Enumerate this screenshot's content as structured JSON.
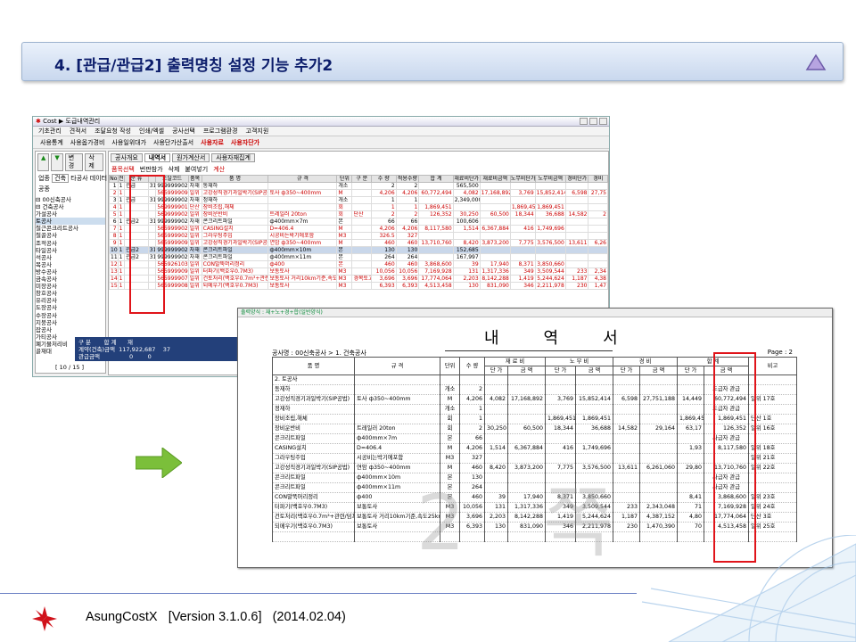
{
  "title": "4. [관급/관급2] 출력명칭 설정 기능 추가2",
  "app": {
    "window_title": "Cost  ▶ 도급내역관리",
    "menu": [
      "기초관리",
      "견적서",
      "조달요청 작성",
      "인쇄/엑셀",
      "공사선택",
      "프로그램환경",
      "고객지원"
    ],
    "toolbar": [
      "사용통계",
      "사용옵가경비",
      "사용일위대가",
      "사용단가산출서",
      "사용자료",
      "사용자단가"
    ],
    "left_buttons": [
      "변경",
      "삭제"
    ],
    "left_labels": [
      "업종",
      "공종"
    ],
    "left_select": "건축",
    "left_select2": "타공사 데이터",
    "tree": [
      "00신축공사",
      "건축공사",
      "가설공사",
      "토공사",
      "철근콘크리트공사",
      "철골공사",
      "조적공사",
      "타일공사",
      "석공사",
      "목공사",
      "방수공사",
      "금속공사",
      "미장공사",
      "창호공사",
      "유리공사",
      "도장공사",
      "수장공사",
      "지붕공사",
      "잡공사",
      "가티공사",
      "폐기물처리비",
      "골재대"
    ],
    "status": "[ 10 / 15 ]",
    "tabs": [
      "공사개요",
      "내역서",
      "원가계산서",
      "사용자재집계"
    ],
    "subbar": [
      "품목선택",
      "번판참가",
      "삭제",
      "붙여넣기",
      "계산"
    ],
    "grid_headers": [
      "No",
      "전",
      "분 류",
      "",
      "조달코드",
      "품목",
      "품 명",
      "규 격",
      "단위",
      "구 분",
      "수 량",
      "적용수량",
      "합 계",
      "재료비단가",
      "재료비금액",
      "노무비단가",
      "노무비금액",
      "경비단가",
      "경비"
    ],
    "grid_rows": [
      [
        "1",
        "1",
        "관급",
        "31",
        "9999999028",
        "자재",
        "동재하",
        "",
        "개소",
        "",
        "2",
        "2",
        "",
        "565,500",
        "",
        "",
        "",
        "",
        ""
      ],
      [
        "2",
        "1",
        "",
        "",
        "5659999092",
        "일위",
        "고강성직경기과일박기(SIP공법)",
        "토사 ф350~400mm",
        "M",
        "",
        "4,206",
        "4,206",
        "60,772,494",
        "4,082",
        "17,168,892",
        "3,769",
        "15,852,414",
        "6,598",
        "27,75"
      ],
      [
        "3",
        "1",
        "관급",
        "31",
        "9999999028",
        "자재",
        "정재하",
        "",
        "개소",
        "",
        "1",
        "1",
        "",
        "2,349,000",
        "",
        "",
        "",
        "",
        ""
      ],
      [
        "4",
        "1",
        "",
        "",
        "5699999019",
        "단산",
        "장비조립,해체",
        "",
        "회",
        "",
        "1",
        "1",
        "1,869,451",
        "",
        "",
        "1,869,451",
        "1,869,451",
        "",
        ""
      ],
      [
        "5",
        "1",
        "",
        "",
        "5699999020",
        "일위",
        "장비운반비",
        "트레일러 20ton",
        "회",
        "단산",
        "2",
        "2",
        "126,352",
        "30,250",
        "60,500",
        "18,344",
        "36,688",
        "14,582",
        "2"
      ],
      [
        "6",
        "1",
        "관급2",
        "31",
        "9999999024",
        "자재",
        "콘크리트파일",
        "ф400mm×7m",
        "본",
        "",
        "66",
        "66",
        "",
        "100,606",
        "",
        "",
        "",
        "",
        ""
      ],
      [
        "7",
        "1",
        "",
        "",
        "5659999023",
        "일위",
        "CASING설치",
        "D=406.4",
        "M",
        "",
        "4,206",
        "4,206",
        "8,117,580",
        "1,514",
        "6,367,884",
        "416",
        "1,749,696",
        "",
        ""
      ],
      [
        "8",
        "1",
        "",
        "",
        "5659999027",
        "일위",
        "그라우팅주입",
        "시공비는박기에포함",
        "M3",
        "",
        "326.5",
        "327",
        "",
        "",
        "",
        "",
        "",
        "",
        ""
      ],
      [
        "9",
        "1",
        "",
        "",
        "5659999092",
        "일위",
        "고강성직경기과일박기(SIP공법)",
        "연암 ф350~400mm",
        "M",
        "",
        "460",
        "460",
        "13,710,760",
        "8,420",
        "3,873,200",
        "7,775",
        "3,576,500",
        "13,611",
        "6,26"
      ],
      [
        "10",
        "1",
        "관급2",
        "31",
        "9999999028",
        "자재",
        "콘크리트파일",
        "ф400mm×10m",
        "본",
        "",
        "130",
        "130",
        "",
        "152,685",
        "",
        "",
        "",
        "",
        ""
      ],
      [
        "11",
        "1",
        "관급2",
        "31",
        "9999999028",
        "자재",
        "콘크리트파일",
        "ф400mm×11m",
        "본",
        "",
        "264",
        "264",
        "",
        "167,997",
        "",
        "",
        "",
        "",
        ""
      ],
      [
        "12",
        "1",
        "",
        "",
        "5659261030",
        "일위",
        "CON말뚝머리정리",
        "ф400",
        "본",
        "",
        "460",
        "460",
        "3,868,600",
        "39",
        "17,940",
        "8,371",
        "3,850,660",
        "",
        ""
      ],
      [
        "13",
        "1",
        "",
        "",
        "5659999092",
        "일위",
        "터파기(백호우0.7M3)",
        "보통토사",
        "M3",
        "",
        "10,056",
        "10,056",
        "7,169,928",
        "131",
        "1,317,336",
        "349",
        "3,509,544",
        "233",
        "2,34"
      ],
      [
        "14",
        "1",
        "",
        "",
        "5659999079",
        "일위",
        "건토처리(백호우0.7m³+관련/덤프15톤)",
        "보통토사 거리10km기준,속도25km",
        "M3",
        "경목토고",
        "3,696",
        "3,696",
        "17,774,064",
        "2,203",
        "8,142,288",
        "1,419",
        "5,244,624",
        "1,187",
        "4,38"
      ],
      [
        "15",
        "1",
        "",
        "",
        "5659999086",
        "일위",
        "되메우기(백호우0.7M3)",
        "보통토사",
        "M3",
        "",
        "6,393",
        "6,393",
        "4,513,458",
        "130",
        "831,090",
        "346",
        "2,211,978",
        "230",
        "1,47"
      ]
    ],
    "sum_labels": [
      "구 분",
      "합 계",
      "재"
    ],
    "sum_row1": [
      "계약(건축)금액",
      "117,922,687",
      "37"
    ],
    "sum_row2": [
      "관급금액",
      "0",
      "0"
    ]
  },
  "report": {
    "top_label": "출력양식 : 재+노+경+합(일반양식)",
    "title": "내역서",
    "meta": "공사명 : 00신축공사 > 1. 건축공사",
    "page": "Page :    2",
    "headers": {
      "name": "품 명",
      "spec": "규 격",
      "unit": "단위",
      "qty": "수 량",
      "mat": "재 료 비",
      "lab": "노 무 비",
      "exp": "경 비",
      "sum": "합 계",
      "note": "비고",
      "unit_price": "단 가",
      "amount": "금 액"
    },
    "rows": [
      [
        "2. 토공사",
        "",
        "",
        "",
        "",
        "",
        "",
        "",
        "",
        "",
        "",
        "",
        ""
      ],
      [
        "동재하",
        "",
        "개소",
        "2",
        "",
        "",
        "",
        "",
        "",
        "",
        "",
        "도급자 관급",
        ""
      ],
      [
        "고강성직경기과일박기(SIP공법)",
        "토사 ф350~400mm",
        "M",
        "4,206",
        "4,082",
        "17,168,892",
        "3,769",
        "15,852,414",
        "6,598",
        "27,751,188",
        "14,449",
        "60,772,494",
        "일위 17호"
      ],
      [
        "정재하",
        "",
        "개소",
        "1",
        "",
        "",
        "",
        "",
        "",
        "",
        "",
        "도급자 관급",
        ""
      ],
      [
        "장비조립,해체",
        "",
        "회",
        "1",
        "",
        "",
        "1,869,451",
        "1,869,451",
        "",
        "",
        "1,869,451",
        "1,869,451",
        "단산 1호"
      ],
      [
        "장비운반비",
        "트레일러 20ton",
        "회",
        "2",
        "30,250",
        "60,500",
        "18,344",
        "36,688",
        "14,582",
        "29,164",
        "63,17",
        "126,352",
        "일위 16호"
      ],
      [
        "콘크리트파일",
        "ф400mm×7m",
        "본",
        "66",
        "",
        "",
        "",
        "",
        "",
        "",
        "",
        "사급자 관급",
        ""
      ],
      [
        "CASING설치",
        "D=406.4",
        "M",
        "4,206",
        "1,514",
        "6,367,884",
        "416",
        "1,749,696",
        "",
        "",
        "1,93",
        "8,117,580",
        "일위 18호"
      ],
      [
        "그라우팅주입",
        "시공비는박기에포함",
        "M3",
        "327",
        "",
        "",
        "",
        "",
        "",
        "",
        "",
        "",
        "일위 21호"
      ],
      [
        "고강성직경기과일박기(SIP공법)",
        "연암 ф350~400mm",
        "M",
        "460",
        "8,420",
        "3,873,200",
        "7,775",
        "3,576,500",
        "13,611",
        "6,261,060",
        "29,80",
        "13,710,760",
        "일위 22호"
      ],
      [
        "콘크리트파일",
        "ф400mm×10m",
        "본",
        "130",
        "",
        "",
        "",
        "",
        "",
        "",
        "",
        "사급자 관급",
        ""
      ],
      [
        "콘크리트파일",
        "ф400mm×11m",
        "본",
        "264",
        "",
        "",
        "",
        "",
        "",
        "",
        "",
        "사급자 관급",
        ""
      ],
      [
        "CON말뚝머리정리",
        "ф400",
        "본",
        "460",
        "39",
        "17,940",
        "8,371",
        "3,850,660",
        "",
        "",
        "8,41",
        "3,868,600",
        "일위 23호"
      ],
      [
        "터파기(백호우0.7M3)",
        "보통토사",
        "M3",
        "10,056",
        "131",
        "1,317,336",
        "349",
        "3,509,544",
        "233",
        "2,343,048",
        "71",
        "7,169,928",
        "일위 24호"
      ],
      [
        "건토처리(백호우0.7m³+관련/덤프15톤)",
        "보통토사 거리10km기준,속도25km",
        "M3",
        "3,696",
        "2,203",
        "8,142,288",
        "1,419",
        "5,244,624",
        "1,187",
        "4,387,152",
        "4,80",
        "17,774,064",
        "단산 3호"
      ],
      [
        "되메우기(백호우0.7M3)",
        "보통토사",
        "M3",
        "6,393",
        "130",
        "831,090",
        "346",
        "2,211,978",
        "230",
        "1,470,390",
        "70",
        "4,513,458",
        "일위 25호"
      ],
      [
        "",
        "",
        "",
        "",
        "",
        "",
        "",
        "",
        "",
        "",
        "",
        "",
        ""
      ]
    ],
    "watermark": "2 쪽"
  },
  "footer": {
    "product": "AsungCostX",
    "version": "[Version 3.1.0.6]",
    "date": "(2014.02.04)"
  }
}
